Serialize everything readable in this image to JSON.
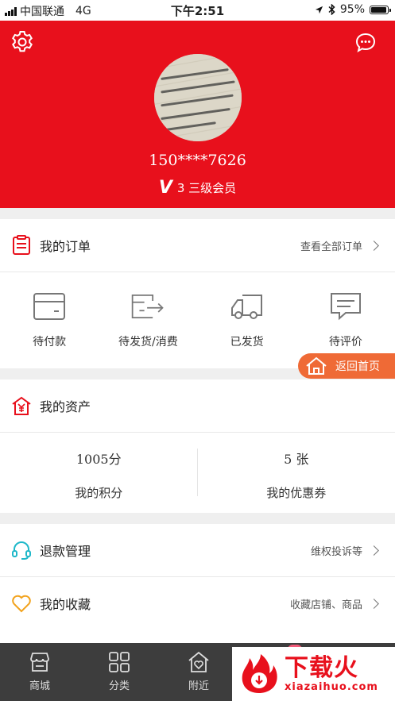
{
  "status_bar": {
    "carrier": "中国联通",
    "network": "4G",
    "time": "下午2:51",
    "battery": "95%",
    "battery_level": 0.95
  },
  "profile": {
    "phone": "150****7626",
    "level_letter": "V",
    "level_text": "3 三级会员"
  },
  "orders": {
    "title": "我的订单",
    "view_all": "查看全部订单",
    "items": [
      {
        "label": "待付款",
        "icon": "wallet-icon"
      },
      {
        "label": "待发货/消费",
        "icon": "box-arrow-icon"
      },
      {
        "label": "已发货",
        "icon": "truck-icon"
      },
      {
        "label": "待评价",
        "icon": "comment-icon"
      }
    ]
  },
  "home_button": {
    "label": "返回首页"
  },
  "assets": {
    "title": "我的资产",
    "points_value": "1005分",
    "points_label": "我的积分",
    "coupons_value": "5 张",
    "coupons_label": "我的优惠券"
  },
  "refund": {
    "title": "退款管理",
    "hint": "维权投诉等"
  },
  "favorites": {
    "title": "我的收藏",
    "hint": "收藏店铺、商品"
  },
  "tabbar": {
    "items": [
      {
        "label": "商城",
        "icon": "store-icon"
      },
      {
        "label": "分类",
        "icon": "grid-icon"
      },
      {
        "label": "附近",
        "icon": "home-heart-icon"
      }
    ]
  },
  "watermark": {
    "title": "下载火",
    "subtitle": "xiazaihuo.com"
  },
  "colors": {
    "brand_red": "#e8101c",
    "accent_orange": "#ef6a36",
    "tabbar": "#3d3d3d"
  }
}
